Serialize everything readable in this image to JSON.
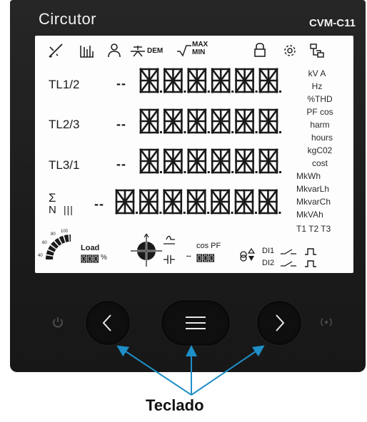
{
  "device": {
    "brand": "Circutor",
    "model": "CVM-C11"
  },
  "rows": [
    {
      "label": "TL1/2",
      "dashes": "--"
    },
    {
      "label": "TL2/3",
      "dashes": "--"
    },
    {
      "label": "TL3/1",
      "dashes": "--"
    }
  ],
  "sum_row": {
    "sigma": "Σ",
    "n": "N",
    "bars": "|||",
    "dashes": "--"
  },
  "top_icons": {
    "dem_label": "DEM",
    "max_label": "MAX",
    "min_label": "MIN"
  },
  "units": {
    "col1": [
      "kV A",
      "Hz",
      "%THD",
      "PF cos",
      "harm",
      "hours",
      "kgC02",
      "cost"
    ],
    "col2": [
      "MkWh",
      "MkvarLh",
      "MkvarCh",
      "MkVAh",
      "T1 T2 T3"
    ]
  },
  "bottom": {
    "load_label": "Load",
    "load_ticks": [
      "40",
      "60",
      "80",
      "100"
    ],
    "percent": "%",
    "cospf_label": "cos PF",
    "cospf_prefix": "--",
    "di1": "DI1",
    "di2": "DI2"
  },
  "callout": {
    "label": "Teclado",
    "color": "#1e8fc8"
  },
  "colors": {
    "body": "#1f1f1f",
    "lcd_bg": "#fdfdfd",
    "segment": "#1a1a1a",
    "led_dim": "#4a4a4a"
  }
}
